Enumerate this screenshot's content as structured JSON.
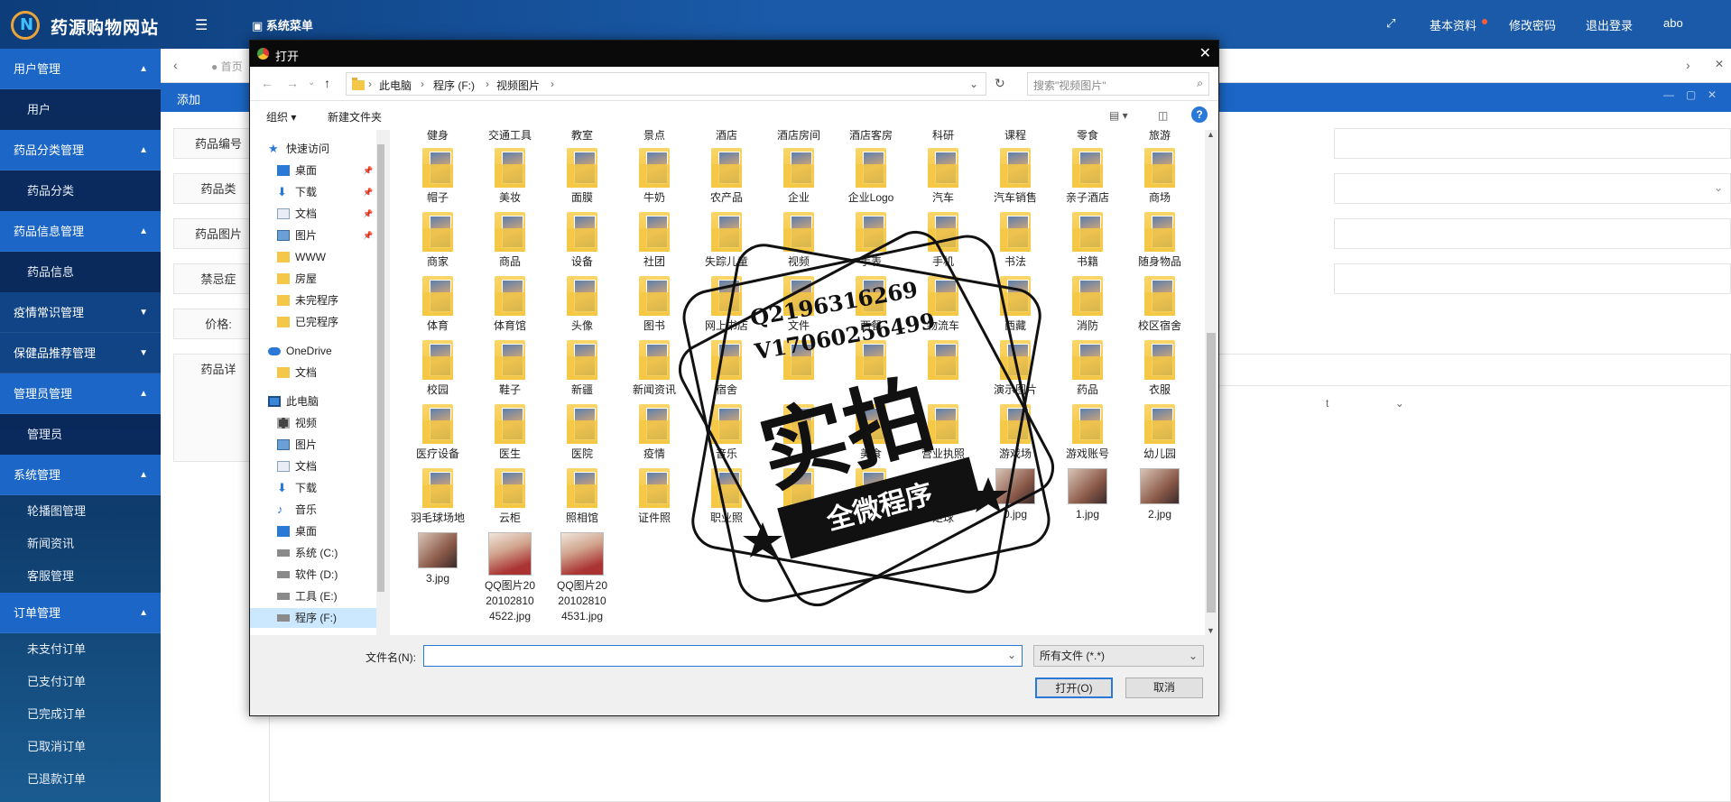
{
  "app": {
    "title": "药源购物网站",
    "system_menu": "系统菜单",
    "base_info": "基本资料",
    "change_password": "修改密码",
    "logout": "退出登录",
    "user": "abo"
  },
  "sidebar": {
    "groups": [
      {
        "label": "用户管理",
        "items": [
          "用户"
        ],
        "expanded": true
      },
      {
        "label": "药品分类管理",
        "items": [
          "药品分类"
        ],
        "expanded": true
      },
      {
        "label": "药品信息管理",
        "items": [
          "药品信息"
        ],
        "expanded": true
      },
      {
        "label": "疫情常识管理",
        "items": [],
        "expanded": false
      },
      {
        "label": "保健品推荐管理",
        "items": [],
        "expanded": false
      },
      {
        "label": "管理员管理",
        "items": [
          "管理员"
        ],
        "expanded": true
      },
      {
        "label": "系统管理",
        "items": [
          "轮播图管理",
          "新闻资讯",
          "客服管理"
        ],
        "expanded": true
      },
      {
        "label": "订单管理",
        "items": [
          "未支付订单",
          "已支付订单",
          "已完成订单",
          "已取消订单",
          "已退款订单"
        ],
        "expanded": true
      }
    ]
  },
  "background": {
    "tab_home": "首页",
    "content_title": "添加",
    "form_labels": [
      "药品编号",
      "药品类",
      "药品图片",
      "禁忌症",
      "价格:",
      "药品详"
    ],
    "dropdown_hint": "t"
  },
  "dialog": {
    "title": "打开",
    "breadcrumb": [
      "此电脑",
      "程序 (F:)",
      "视频图片"
    ],
    "search_placeholder": "搜索\"视频图片\"",
    "organize": "组织",
    "new_folder": "新建文件夹",
    "nav": [
      {
        "label": "快速访问",
        "icon": "star-icon",
        "pinned": false
      },
      {
        "label": "桌面",
        "icon": "desktop-icon",
        "pinned": true
      },
      {
        "label": "下载",
        "icon": "download-icon",
        "pinned": true
      },
      {
        "label": "文档",
        "icon": "document-icon",
        "pinned": true
      },
      {
        "label": "图片",
        "icon": "picture-icon",
        "pinned": true
      },
      {
        "label": "WWW",
        "icon": "folder-icon",
        "pinned": false
      },
      {
        "label": "房屋",
        "icon": "folder-icon",
        "pinned": false
      },
      {
        "label": "未完程序",
        "icon": "folder-icon",
        "pinned": false
      },
      {
        "label": "已完程序",
        "icon": "folder-icon",
        "pinned": false
      },
      {
        "label": "OneDrive",
        "icon": "cloud-icon",
        "pinned": false
      },
      {
        "label": "文档",
        "icon": "folder-icon",
        "pinned": false
      },
      {
        "label": "此电脑",
        "icon": "computer-icon",
        "pinned": false
      },
      {
        "label": "视频",
        "icon": "video-icon",
        "pinned": false
      },
      {
        "label": "图片",
        "icon": "picture-icon",
        "pinned": false
      },
      {
        "label": "文档",
        "icon": "document-icon",
        "pinned": false
      },
      {
        "label": "下载",
        "icon": "download-icon",
        "pinned": false
      },
      {
        "label": "音乐",
        "icon": "music-icon",
        "pinned": false
      },
      {
        "label": "桌面",
        "icon": "desktop-icon",
        "pinned": false
      },
      {
        "label": "系统 (C:)",
        "icon": "drive-icon",
        "pinned": false
      },
      {
        "label": "软件 (D:)",
        "icon": "drive-icon",
        "pinned": false
      },
      {
        "label": "工具 (E:)",
        "icon": "drive-icon",
        "pinned": false
      },
      {
        "label": "程序 (F:)",
        "icon": "drive-icon",
        "pinned": false
      }
    ],
    "top_partial_labels": [
      "健身",
      "交通工具",
      "教室",
      "景点",
      "酒店",
      "酒店房间",
      "酒店客房",
      "科研",
      "课程",
      "零食",
      "旅游"
    ],
    "files": [
      "帽子",
      "美妆",
      "面膜",
      "牛奶",
      "农产品",
      "企业",
      "企业Logo",
      "汽车",
      "汽车销售",
      "亲子酒店",
      "商场",
      "商家",
      "商品",
      "设备",
      "社团",
      "失踪儿童",
      "视频",
      "手表",
      "手机",
      "书法",
      "书籍",
      "随身物品",
      "体育",
      "体育馆",
      "头像",
      "图书",
      "网上书店",
      "文件",
      "西餐",
      "物流车",
      "西藏",
      "消防",
      "校区宿舍",
      "校园",
      "鞋子",
      "新疆",
      "新闻资讯",
      "宿舍",
      "",
      "",
      "",
      "演示图片",
      "药品",
      "衣服",
      "医疗设备",
      "医生",
      "医院",
      "疫情",
      "音乐",
      "",
      "美食",
      "营业执照",
      "游戏场",
      "游戏账号",
      "幼儿园",
      "羽毛球场地",
      "云柜",
      "照相馆",
      "证件照",
      "职业照",
      "志愿者",
      "",
      "足球",
      "0.jpg",
      "1.jpg",
      "2.jpg",
      "3.jpg",
      "QQ图片20201028104522.jpg",
      "QQ图片20201028104531.jpg"
    ],
    "filename_label": "文件名(N):",
    "filename_value": "",
    "filetype": "所有文件 (*.*)",
    "open_button": "打开(O)",
    "cancel_button": "取消"
  },
  "watermark": {
    "line1": "Q2196316269",
    "line2": "V17060256499",
    "big": "实拍",
    "banner": "全微程序"
  }
}
